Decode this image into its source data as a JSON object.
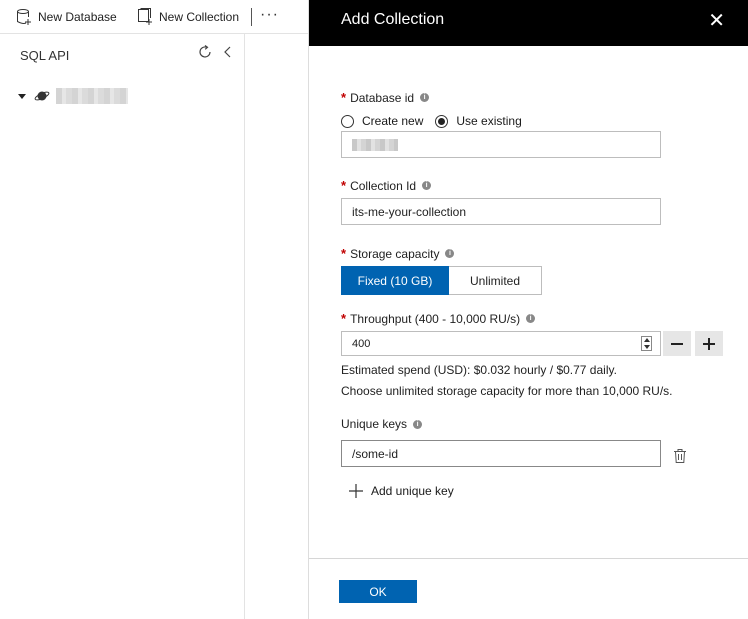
{
  "toolbar": {
    "new_database_label": "New Database",
    "new_collection_label": "New Collection",
    "more_label": "···"
  },
  "explorer": {
    "title": "SQL API"
  },
  "panel": {
    "title": "Add Collection",
    "close_label": "✕",
    "database_id": {
      "label": "Database id",
      "option_create": "Create new",
      "option_existing": "Use existing",
      "selected": "Use existing"
    },
    "collection_id": {
      "label": "Collection Id",
      "value": "its-me-your-collection"
    },
    "storage_capacity": {
      "label": "Storage capacity",
      "options": [
        "Fixed (10 GB)",
        "Unlimited"
      ],
      "selected": "Fixed (10 GB)"
    },
    "throughput": {
      "label": "Throughput (400 - 10,000 RU/s)",
      "value": "400",
      "decrement_label": "−",
      "increment_label": "+",
      "estimate": "Estimated spend (USD): $0.032 hourly / $0.77 daily.",
      "hint": "Choose unlimited storage capacity for more than 10,000 RU/s."
    },
    "unique_keys": {
      "label": "Unique keys",
      "value": "/some-id",
      "add_label": "Add unique key"
    },
    "ok_label": "OK"
  },
  "colors": {
    "accent": "#0063b1",
    "header_bg": "#000000",
    "required": "#c00000"
  }
}
